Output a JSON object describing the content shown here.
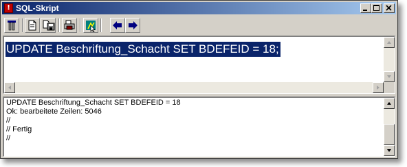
{
  "window": {
    "title": "SQL-Skript",
    "icon": "app-red-icon",
    "controls": [
      "minimize-icon",
      "maximize-icon",
      "close-icon"
    ]
  },
  "toolbar": {
    "buttons": [
      {
        "icon": "table-icon"
      },
      {
        "icon": "new-document-icon"
      },
      {
        "icon": "save-documents-icon"
      },
      {
        "icon": "print-icon"
      },
      {
        "icon": "execute-run-icon"
      },
      {
        "icon": "arrow-left-icon"
      },
      {
        "icon": "arrow-right-icon"
      }
    ]
  },
  "editor": {
    "sql": "UPDATE Beschriftung_Schacht SET BDEFEID = 18;"
  },
  "output": {
    "lines": [
      "UPDATE Beschriftung_Schacht SET BDEFEID = 18",
      "Ok: bearbeitete Zeilen: 5046",
      "//",
      "// Fertig",
      "//"
    ]
  },
  "colors": {
    "titlebar_start": "#0a246a",
    "titlebar_end": "#a6caf0",
    "selection": "#0a246a",
    "face": "#d4d0c8"
  }
}
